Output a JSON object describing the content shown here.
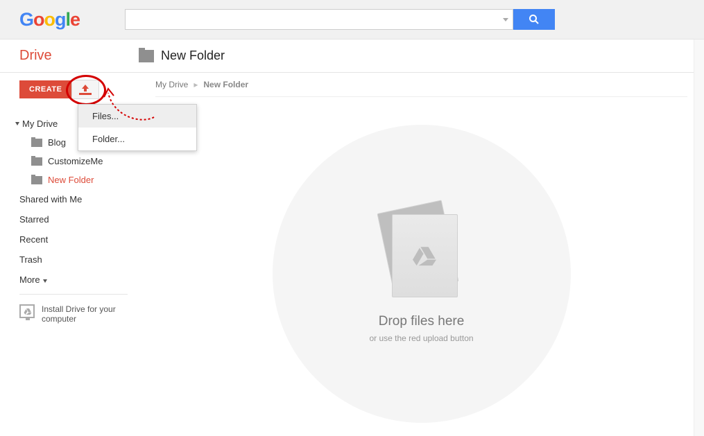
{
  "logo_letters": [
    "G",
    "o",
    "o",
    "g",
    "l",
    "e"
  ],
  "app_title": "Drive",
  "location_title": "New Folder",
  "breadcrumb": {
    "root": "My Drive",
    "current": "New Folder"
  },
  "create_label": "CREATE",
  "nav": {
    "root": "My Drive",
    "items": [
      {
        "label": "Blog"
      },
      {
        "label": "CustomizeMe"
      },
      {
        "label": "New Folder",
        "current": true
      }
    ]
  },
  "plain_nav": [
    "Shared with Me",
    "Starred",
    "Recent",
    "Trash"
  ],
  "more_label": "More",
  "install_label": "Install Drive for your computer",
  "upload_menu": {
    "files": "Files...",
    "folder": "Folder..."
  },
  "dropzone": {
    "title": "Drop files here",
    "sub": "or use the red upload button"
  }
}
